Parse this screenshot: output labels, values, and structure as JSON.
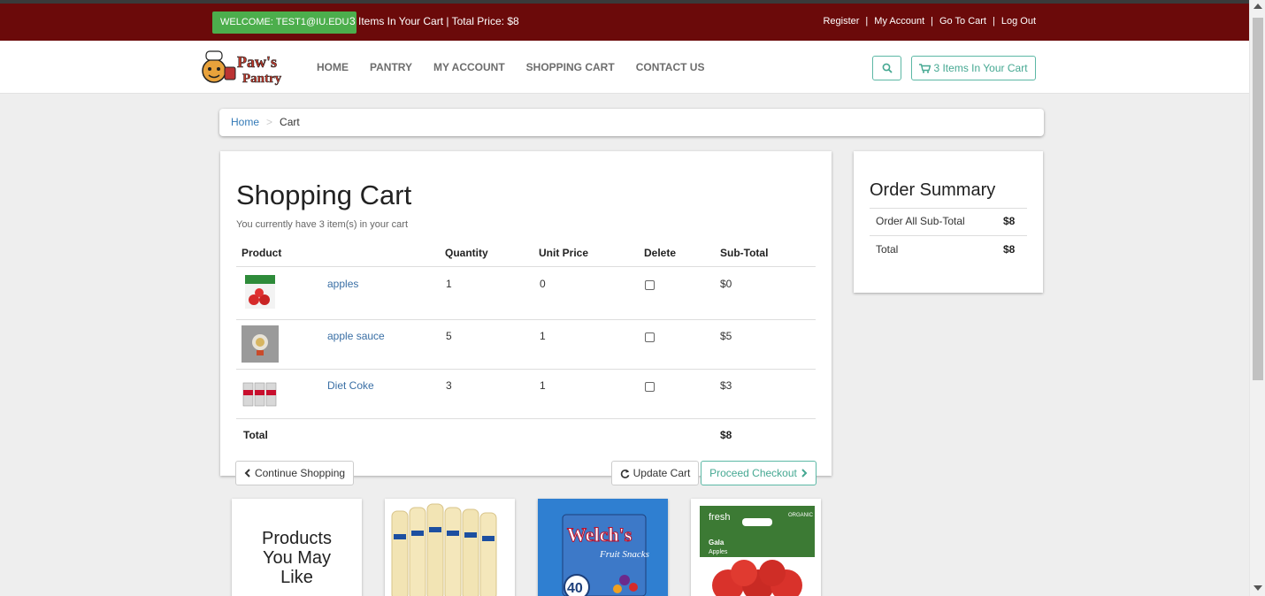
{
  "topbar": {
    "welcome": "WELCOME: TEST1@IU.EDU",
    "cart_info": "3 Items In Your Cart | Total Price: $8",
    "links": [
      "Register",
      "My Account",
      "Go To Cart",
      "Log Out"
    ]
  },
  "nav": {
    "logo_text": "Paw's Pantry",
    "items": [
      "HOME",
      "PANTRY",
      "MY ACCOUNT",
      "SHOPPING CART",
      "CONTACT US"
    ],
    "cart_button": "3 Items In Your Cart"
  },
  "breadcrumb": {
    "home": "Home",
    "current": "Cart"
  },
  "cart": {
    "title": "Shopping Cart",
    "subtitle": "You currently have 3 item(s) in your cart",
    "headers": {
      "product": "Product",
      "quantity": "Quantity",
      "unit_price": "Unit Price",
      "delete": "Delete",
      "subtotal": "Sub-Total"
    },
    "rows": [
      {
        "name": "apples",
        "quantity": "1",
        "unit_price": "0",
        "subtotal": "$0",
        "image": "apples-bag-image"
      },
      {
        "name": "apple sauce",
        "quantity": "5",
        "unit_price": "1",
        "subtotal": "$5",
        "image": "apple-sauce-image"
      },
      {
        "name": "Diet Coke",
        "quantity": "3",
        "unit_price": "1",
        "subtotal": "$3",
        "image": "diet-coke-image"
      }
    ],
    "total_label": "Total",
    "total_value": "$8",
    "buttons": {
      "continue": "Continue Shopping",
      "update": "Update Cart",
      "checkout": "Proceed Checkout"
    }
  },
  "summary": {
    "title": "Order Summary",
    "subtotal_label": "Order All Sub-Total",
    "subtotal_value": "$8",
    "total_label": "Total",
    "total_value": "$8"
  },
  "recommendations": {
    "title": "Products You May Like",
    "items": [
      "Suave lotion bottles",
      "Welch's Fruit Snacks",
      "Gala Apples"
    ],
    "badge_40": "40",
    "welchs": "Welch's",
    "fruit_snacks": "Fruit Snacks",
    "fresh": "fresh",
    "organic": "ORGANIC",
    "gala": "Gala",
    "apples": "Apples"
  },
  "colors": {
    "topbar": "#6b0a0a",
    "welcome": "#4cae4c",
    "accent": "#5cb8a5",
    "link": "#337ab7"
  }
}
